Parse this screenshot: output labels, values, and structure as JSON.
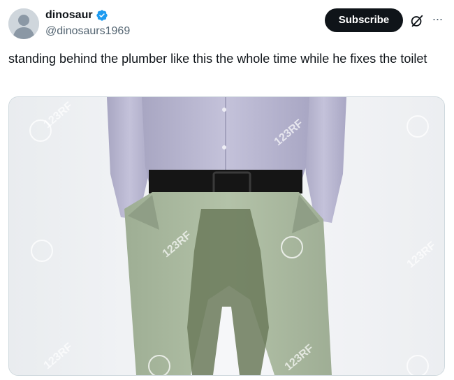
{
  "author": {
    "display_name": "dinosaur",
    "handle": "@dinosaurs1969",
    "verified_icon": "verified-badge-icon",
    "avatar_icon": "default-avatar-icon"
  },
  "actions": {
    "subscribe_label": "Subscribe",
    "grok_icon": "grok-icon",
    "more_icon": "more-options-icon",
    "more_glyph": "···"
  },
  "tweet": {
    "text": "standing behind the plumber like this the whole time while he fixes the toilet"
  },
  "media": {
    "watermark_text": "123RF"
  },
  "colors": {
    "verified_blue": "#1d9bf0",
    "button_bg": "#0f1419",
    "secondary_text": "#536471",
    "border": "#cfd9de"
  }
}
